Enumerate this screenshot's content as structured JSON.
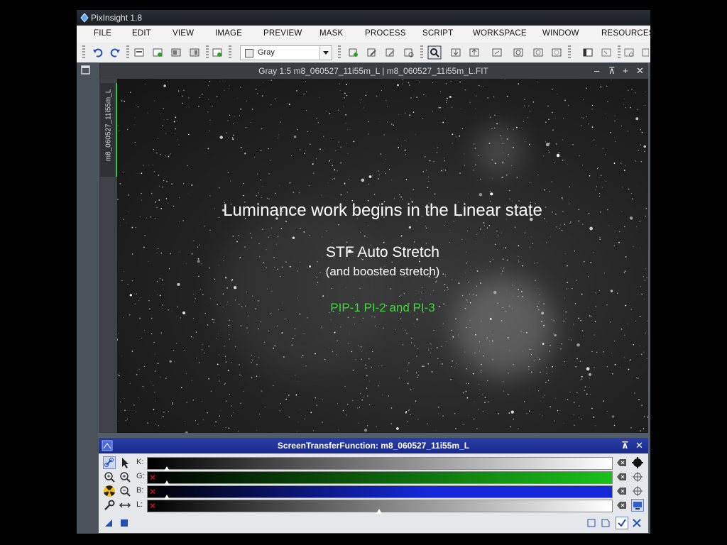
{
  "app": {
    "title": "PixInsight 1.8"
  },
  "menu": [
    "FILE",
    "EDIT",
    "VIEW",
    "IMAGE",
    "PREVIEW",
    "MASK",
    "PROCESS",
    "SCRIPT",
    "WORKSPACE",
    "WINDOW",
    "RESOURCES"
  ],
  "toolbar": {
    "color_space": "Gray"
  },
  "image_window": {
    "title": "Gray 1:5 m8_060527_11i55m_L | m8_060527_11i55m_L.FIT",
    "side_tab": "m8_060527_11i55m_L"
  },
  "overlay": {
    "line1": "Luminance work begins in the Linear state",
    "line2": "STF Auto Stretch",
    "line3": "(and boosted stretch)",
    "line4": "PIP-1 PI-2 and PI-3"
  },
  "stf": {
    "title": "ScreenTransferFunction: m8_060527_11i55m_L",
    "channels": [
      {
        "label": "K:",
        "color": "#ffffff"
      },
      {
        "label": "G:",
        "color": "#19c219"
      },
      {
        "label": "B:",
        "color": "#1428d8"
      },
      {
        "label": "L:",
        "color": "#ffffff"
      }
    ]
  },
  "colors": {
    "stf_header": "#1f33a0",
    "overlay_green": "#3cd83c",
    "tab_accent": "#36c23a"
  }
}
